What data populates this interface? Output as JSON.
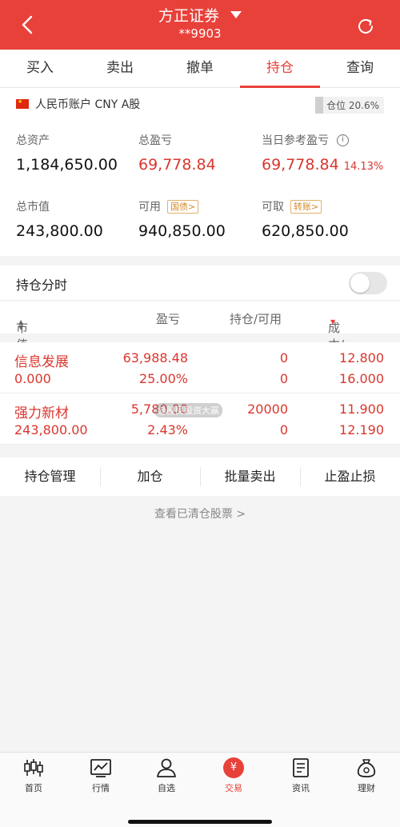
{
  "header": {
    "title": "方正证券",
    "account_masked": "**9903"
  },
  "tabs": [
    {
      "label": "买入"
    },
    {
      "label": "卖出"
    },
    {
      "label": "撤单"
    },
    {
      "label": "持仓"
    },
    {
      "label": "查询"
    }
  ],
  "account": {
    "currency_line": "人民币账户 CNY A股",
    "position_ratio": "仓位 20.6%",
    "total_assets_label": "总资产",
    "total_assets": "1,184,650.00",
    "total_pl_label": "总盈亏",
    "total_pl": "69,778.84",
    "daily_pl_label": "当日参考盈亏",
    "daily_pl": "69,778.84",
    "daily_pl_pct": "14.13%",
    "market_value_label": "总市值",
    "market_value": "243,800.00",
    "available_label": "可用",
    "available_tag": "国债>",
    "available": "940,850.00",
    "withdrawable_label": "可取",
    "withdrawable_tag": "转账>",
    "withdrawable": "620,850.00"
  },
  "intraday": {
    "label": "持仓分时",
    "enabled": false
  },
  "columns": {
    "market_value": "市值",
    "pl": "盈亏",
    "position": "持仓/可用",
    "cost_price": "成本/现价"
  },
  "holdings": [
    {
      "name": "信息发展",
      "market_value": "0.000",
      "pl": "63,988.48",
      "pl_pct": "25.00%",
      "position": "0",
      "available": "0",
      "cost": "12.800",
      "price": "16.000"
    },
    {
      "name": "强力新材",
      "market_value": "243,800.00",
      "pl": "5,780.00",
      "pl_pct": "2.43%",
      "position": "20000",
      "available": "0",
      "cost": "11.900",
      "price": "12.190",
      "watermark": "@股民股资大赢"
    }
  ],
  "actions": [
    "持仓管理",
    "加仓",
    "批量卖出",
    "止盈止损"
  ],
  "cleared_link": "查看已清仓股票 >",
  "bottom_nav": [
    {
      "label": "首页",
      "icon": "candlestick-icon"
    },
    {
      "label": "行情",
      "icon": "chart-icon"
    },
    {
      "label": "自选",
      "icon": "person-icon"
    },
    {
      "label": "交易",
      "icon": "yuan-icon"
    },
    {
      "label": "资讯",
      "icon": "document-icon"
    },
    {
      "label": "理财",
      "icon": "money-bag-icon"
    }
  ],
  "colors": {
    "brand": "#e8413a",
    "profit": "#d9372f",
    "tag": "#d28a2d"
  }
}
